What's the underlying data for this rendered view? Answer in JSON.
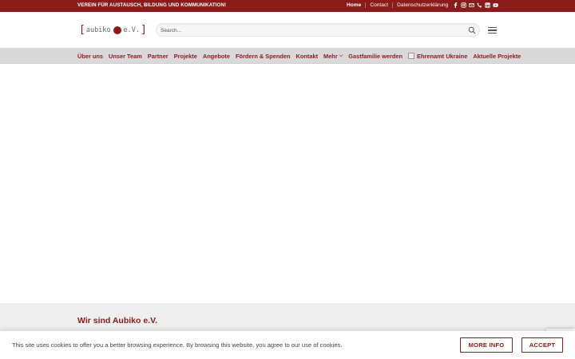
{
  "topbar": {
    "tagline": "VEREIN FÜR AUSTAUSCH, BILDUNG UND KOMMUNIKATION!",
    "links": [
      "Home",
      "Contact",
      "Datenschutzerklärung"
    ],
    "social_icons": [
      "facebook-icon",
      "instagram-icon",
      "email-icon",
      "phone-icon",
      "linkedin-icon",
      "youtube-icon"
    ],
    "bg_color": "#8b1a1a"
  },
  "header": {
    "logo": {
      "left": "aubiko",
      "right": "e.V."
    },
    "search_placeholder": "Search...",
    "search_icon": "search-icon",
    "menu_icon": "hamburger-menu-icon"
  },
  "nav": {
    "items": [
      "Über uns",
      "Unser Team",
      "Partner",
      "Projekte",
      "Angebote",
      "Fördern & Spenden",
      "Kontakt",
      "Mehr",
      "Gastfamilie werden",
      "Ehrenamt Ukraine",
      "Aktuelle Projekte"
    ],
    "accent_color": "#8b1a1a"
  },
  "footer": {
    "heading": "Wir sind Aubiko e.V."
  },
  "cookie_bar": {
    "message": "This site uses cookies to offer you a better browsing experience. By browsing this website, you agree to our use of cookies.",
    "more_info": "MORE INFO",
    "accept": "ACCEPT"
  }
}
